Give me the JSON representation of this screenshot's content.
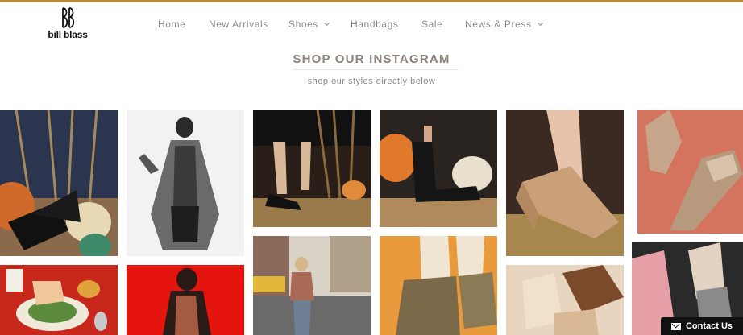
{
  "brand": {
    "logo_text": "bill blass"
  },
  "nav": {
    "items": [
      {
        "label": "Home",
        "has_dropdown": false
      },
      {
        "label": "New Arrivals",
        "has_dropdown": false
      },
      {
        "label": "Shoes",
        "has_dropdown": true
      },
      {
        "label": "Handbags",
        "has_dropdown": false
      },
      {
        "label": "Sale",
        "has_dropdown": false
      },
      {
        "label": "News & Press",
        "has_dropdown": true
      }
    ]
  },
  "instagram": {
    "heading": "SHOP OUR INSTAGRAM",
    "subheading": "shop our styles directly below"
  },
  "contact": {
    "label": "Contact Us",
    "icon": "envelope-icon"
  },
  "colors": {
    "accent": "#b8863b",
    "heading": "#8c8278",
    "nav_text": "#8a8a8a"
  }
}
